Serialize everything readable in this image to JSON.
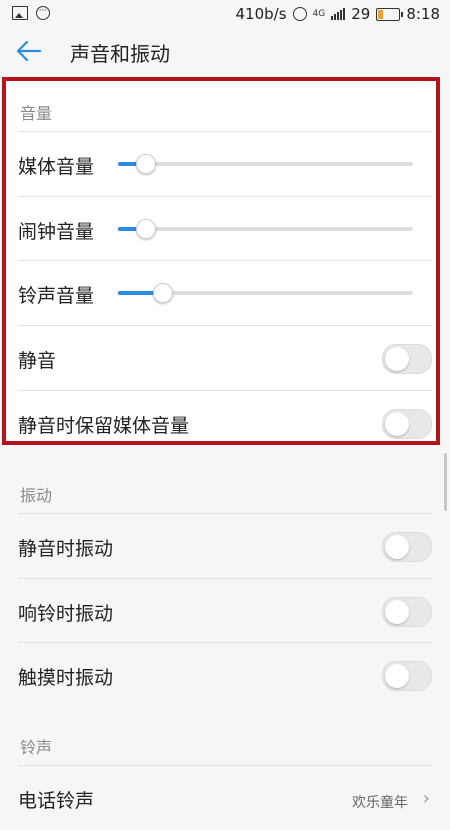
{
  "status_bar": {
    "speed": "410b/s",
    "network": "4G",
    "battery": "29",
    "time": "8:18",
    "icons": [
      "image-icon",
      "message-icon",
      "alarm-icon",
      "signal-icon",
      "battery-icon"
    ]
  },
  "app_bar": {
    "title": "声音和振动",
    "back_icon": "arrow-left-icon"
  },
  "sections": {
    "volume": {
      "header": "音量",
      "media_label": "媒体音量",
      "media_level": 0.09,
      "alarm_label": "闹钟音量",
      "alarm_level": 0.09,
      "ringtone_label": "铃声音量",
      "ringtone_level": 0.15,
      "mute_label": "静音",
      "mute_on": false,
      "keep_media_label": "静音时保留媒体音量",
      "keep_media_on": false
    },
    "vibration": {
      "header": "振动",
      "on_mute_label": "静音时振动",
      "on_mute_on": false,
      "on_ring_label": "响铃时振动",
      "on_ring_on": false,
      "on_touch_label": "触摸时振动",
      "on_touch_on": false
    },
    "ringtone": {
      "header": "铃声",
      "phone_label": "电话铃声",
      "phone_value": "欢乐童年"
    }
  },
  "colors": {
    "accent": "#2a8de0",
    "highlight": "#b5141c"
  }
}
